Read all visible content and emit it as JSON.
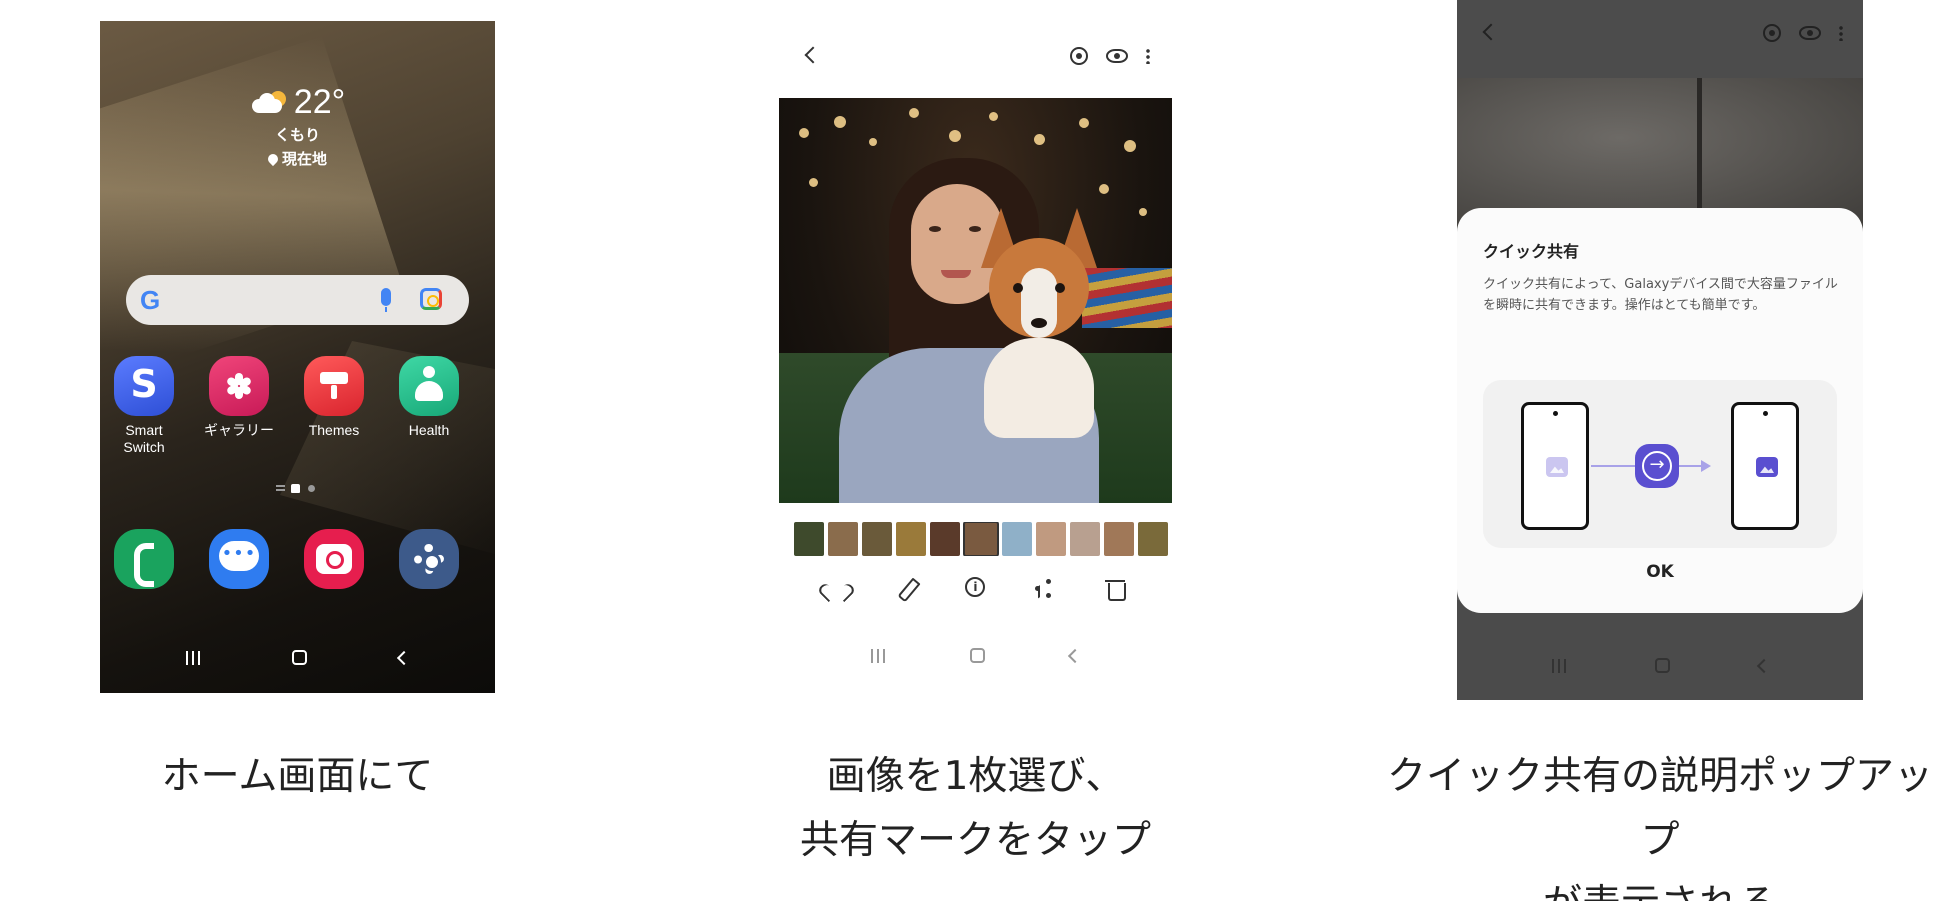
{
  "colors": {
    "accent_purple": "#5a4fd0",
    "gallery_pink": "#e0215e",
    "themes_red": "#e8343a",
    "health_green": "#22b585",
    "phone_green": "#1aa35e",
    "messages_blue": "#2f7cf0",
    "camera_red": "#e61e4e",
    "settings_blue": "#3d5a8a"
  },
  "panel1": {
    "weather": {
      "temperature": "22°",
      "condition": "くもり",
      "location": "現在地"
    },
    "apps": [
      {
        "label": "Smart\nSwitch",
        "icon": "smart-switch-icon"
      },
      {
        "label": "ギャラリー",
        "icon": "gallery-flower-icon"
      },
      {
        "label": "Themes",
        "icon": "themes-brush-icon"
      },
      {
        "label": "Health",
        "icon": "health-person-icon"
      }
    ],
    "dock": [
      "phone-icon",
      "messages-icon",
      "camera-icon",
      "settings-gear-icon"
    ],
    "caption": "ホーム画面にて"
  },
  "panel2": {
    "thumb_colors": [
      "#3e4a2c",
      "#8a6c4c",
      "#6a5a3a",
      "#9a7a3a",
      "#5a3a2a",
      "#7a5a40",
      "#8fb0c8",
      "#c09a80",
      "#b8a090",
      "#a07858",
      "#7a6a3a"
    ],
    "caption": "画像を1枚選び、\n共有マークをタップ"
  },
  "panel3": {
    "dialog_title": "クイック共有",
    "dialog_body": "クイック共有によって、Galaxyデバイス間で大容量ファイルを瞬時に共有できます。操作はとても簡単です。",
    "ok_label": "OK",
    "caption": "クイック共有の説明ポップアップ\nが表示される"
  }
}
